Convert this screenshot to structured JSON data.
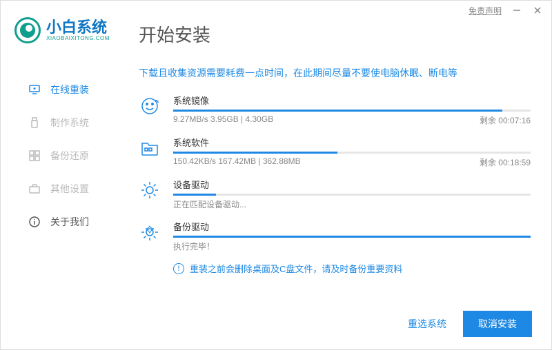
{
  "titlebar": {
    "disclaimer": "免责声明"
  },
  "logo": {
    "text_cn": "小白系统",
    "text_en": "XIAOBAIXITONG.COM"
  },
  "page_title": "开始安装",
  "sidebar": {
    "items": [
      {
        "label": "在线重装"
      },
      {
        "label": "制作系统"
      },
      {
        "label": "备份还原"
      },
      {
        "label": "其他设置"
      },
      {
        "label": "关于我们"
      }
    ]
  },
  "main_tip": "下载且收集资源需要耗费一点时间，在此期间尽量不要使电脑休眠、断电等",
  "tasks": [
    {
      "title": "系统镜像",
      "stats": "9.27MB/s 3.95GB | 4.30GB",
      "remain": "剩余 00:07:16",
      "progress_pct": 92
    },
    {
      "title": "系统软件",
      "stats": "150.42KB/s 167.42MB | 362.88MB",
      "remain": "剩余 00:18:59",
      "progress_pct": 46
    },
    {
      "title": "设备驱动",
      "status": "正在匹配设备驱动...",
      "progress_pct": 12
    },
    {
      "title": "备份驱动",
      "status": "执行完毕！",
      "progress_pct": 100
    }
  ],
  "warning": "重装之前会删除桌面及C盘文件，请及时备份重要资料",
  "footer": {
    "reselect": "重选系统",
    "cancel": "取消安装"
  }
}
